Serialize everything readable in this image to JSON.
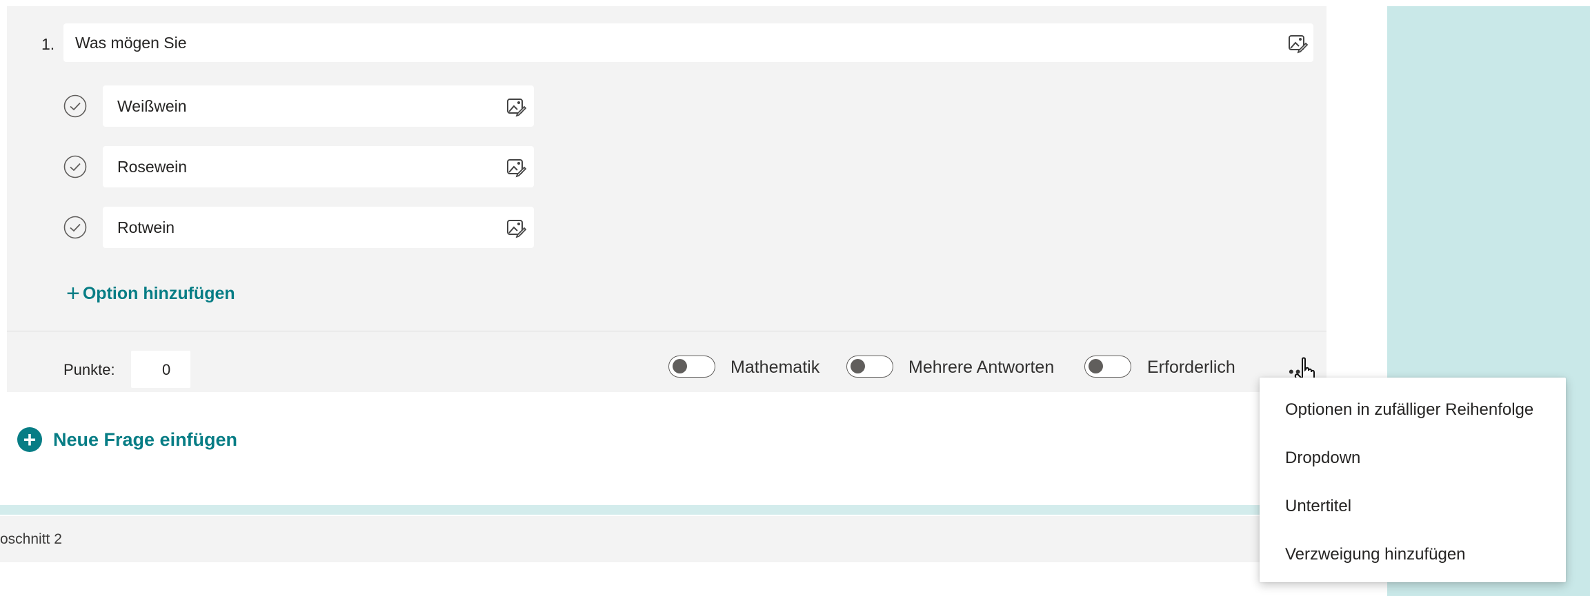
{
  "question": {
    "number": "1.",
    "title": "Was mögen Sie",
    "options": [
      {
        "label": "Weißwein"
      },
      {
        "label": "Rosewein"
      },
      {
        "label": "Rotwein"
      }
    ],
    "add_option_label": "Option hinzufügen"
  },
  "footer": {
    "points_label": "Punkte:",
    "points_value": "0",
    "toggles": [
      {
        "label": "Mathematik",
        "on": false
      },
      {
        "label": "Mehrere Antworten",
        "on": false
      },
      {
        "label": "Erforderlich",
        "on": false
      }
    ],
    "more_label": "•••"
  },
  "new_question_label": "Neue Frage einfügen",
  "section_label": "oschnitt 2",
  "menu": {
    "items": [
      {
        "label": "Optionen in zufälliger Reihenfolge"
      },
      {
        "label": "Dropdown"
      },
      {
        "label": "Untertitel"
      },
      {
        "label": "Verzweigung hinzufügen"
      }
    ]
  },
  "colors": {
    "accent": "#077d85",
    "side_panel": "#c9e8e8",
    "card_background": "#f3f3f3"
  }
}
